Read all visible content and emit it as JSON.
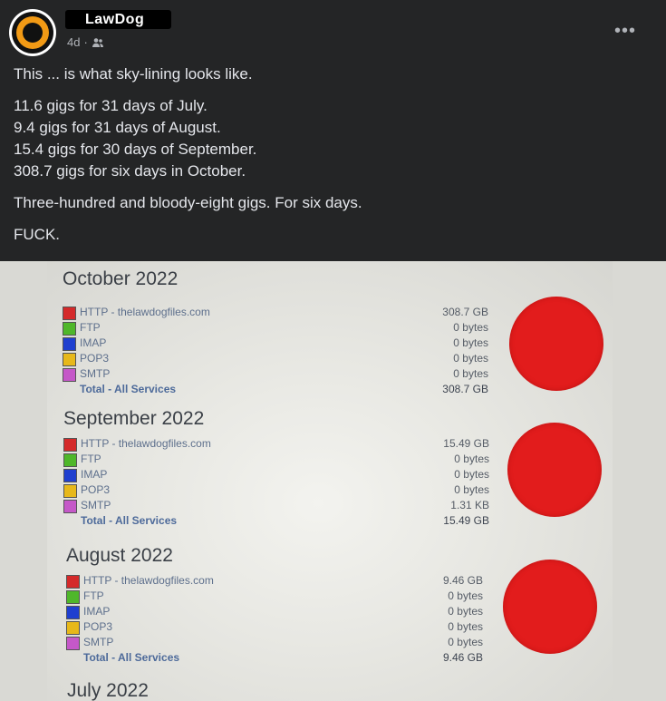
{
  "post": {
    "author": "LawDog",
    "time": "4d",
    "audience_icon": "friends-icon",
    "more_icon": "more-options-icon",
    "paragraphs": [
      "This ... is what sky-lining looks like.",
      "11.6 gigs for 31 days of July.",
      "9.4 gigs for 31 days of August.",
      "15.4 gigs for 30 days of September.",
      "308.7 gigs for six days in October.",
      "Three-hundred and bloody-eight gigs. For six days.",
      "FUCK."
    ]
  },
  "colors": {
    "http": "#d42a2a",
    "ftp": "#4fb72a",
    "imap": "#1f3fcf",
    "pop3": "#e7b81a",
    "smtp": "#c558c8",
    "pie": "#e21c1c"
  },
  "photo": {
    "months": [
      {
        "title": "October 2022",
        "rows": [
          {
            "label": "HTTP - thelawdogfiles.com",
            "value": "308.7 GB",
            "color": "http"
          },
          {
            "label": "FTP",
            "value": "0 bytes",
            "color": "ftp"
          },
          {
            "label": "IMAP",
            "value": "0 bytes",
            "color": "imap"
          },
          {
            "label": "POP3",
            "value": "0 bytes",
            "color": "pop3"
          },
          {
            "label": "SMTP",
            "value": "0 bytes",
            "color": "smtp"
          }
        ],
        "total_label": "Total - All Services",
        "total_value": "308.7 GB"
      },
      {
        "title": "September 2022",
        "rows": [
          {
            "label": "HTTP - thelawdogfiles.com",
            "value": "15.49 GB",
            "color": "http"
          },
          {
            "label": "FTP",
            "value": "0 bytes",
            "color": "ftp"
          },
          {
            "label": "IMAP",
            "value": "0 bytes",
            "color": "imap"
          },
          {
            "label": "POP3",
            "value": "0 bytes",
            "color": "pop3"
          },
          {
            "label": "SMTP",
            "value": "1.31 KB",
            "color": "smtp"
          }
        ],
        "total_label": "Total - All Services",
        "total_value": "15.49 GB"
      },
      {
        "title": "August 2022",
        "rows": [
          {
            "label": "HTTP - thelawdogfiles.com",
            "value": "9.46 GB",
            "color": "http"
          },
          {
            "label": "FTP",
            "value": "0 bytes",
            "color": "ftp"
          },
          {
            "label": "IMAP",
            "value": "0 bytes",
            "color": "imap"
          },
          {
            "label": "POP3",
            "value": "0 bytes",
            "color": "pop3"
          },
          {
            "label": "SMTP",
            "value": "0 bytes",
            "color": "smtp"
          }
        ],
        "total_label": "Total - All Services",
        "total_value": "9.46 GB"
      },
      {
        "title": "July 2022"
      }
    ]
  }
}
